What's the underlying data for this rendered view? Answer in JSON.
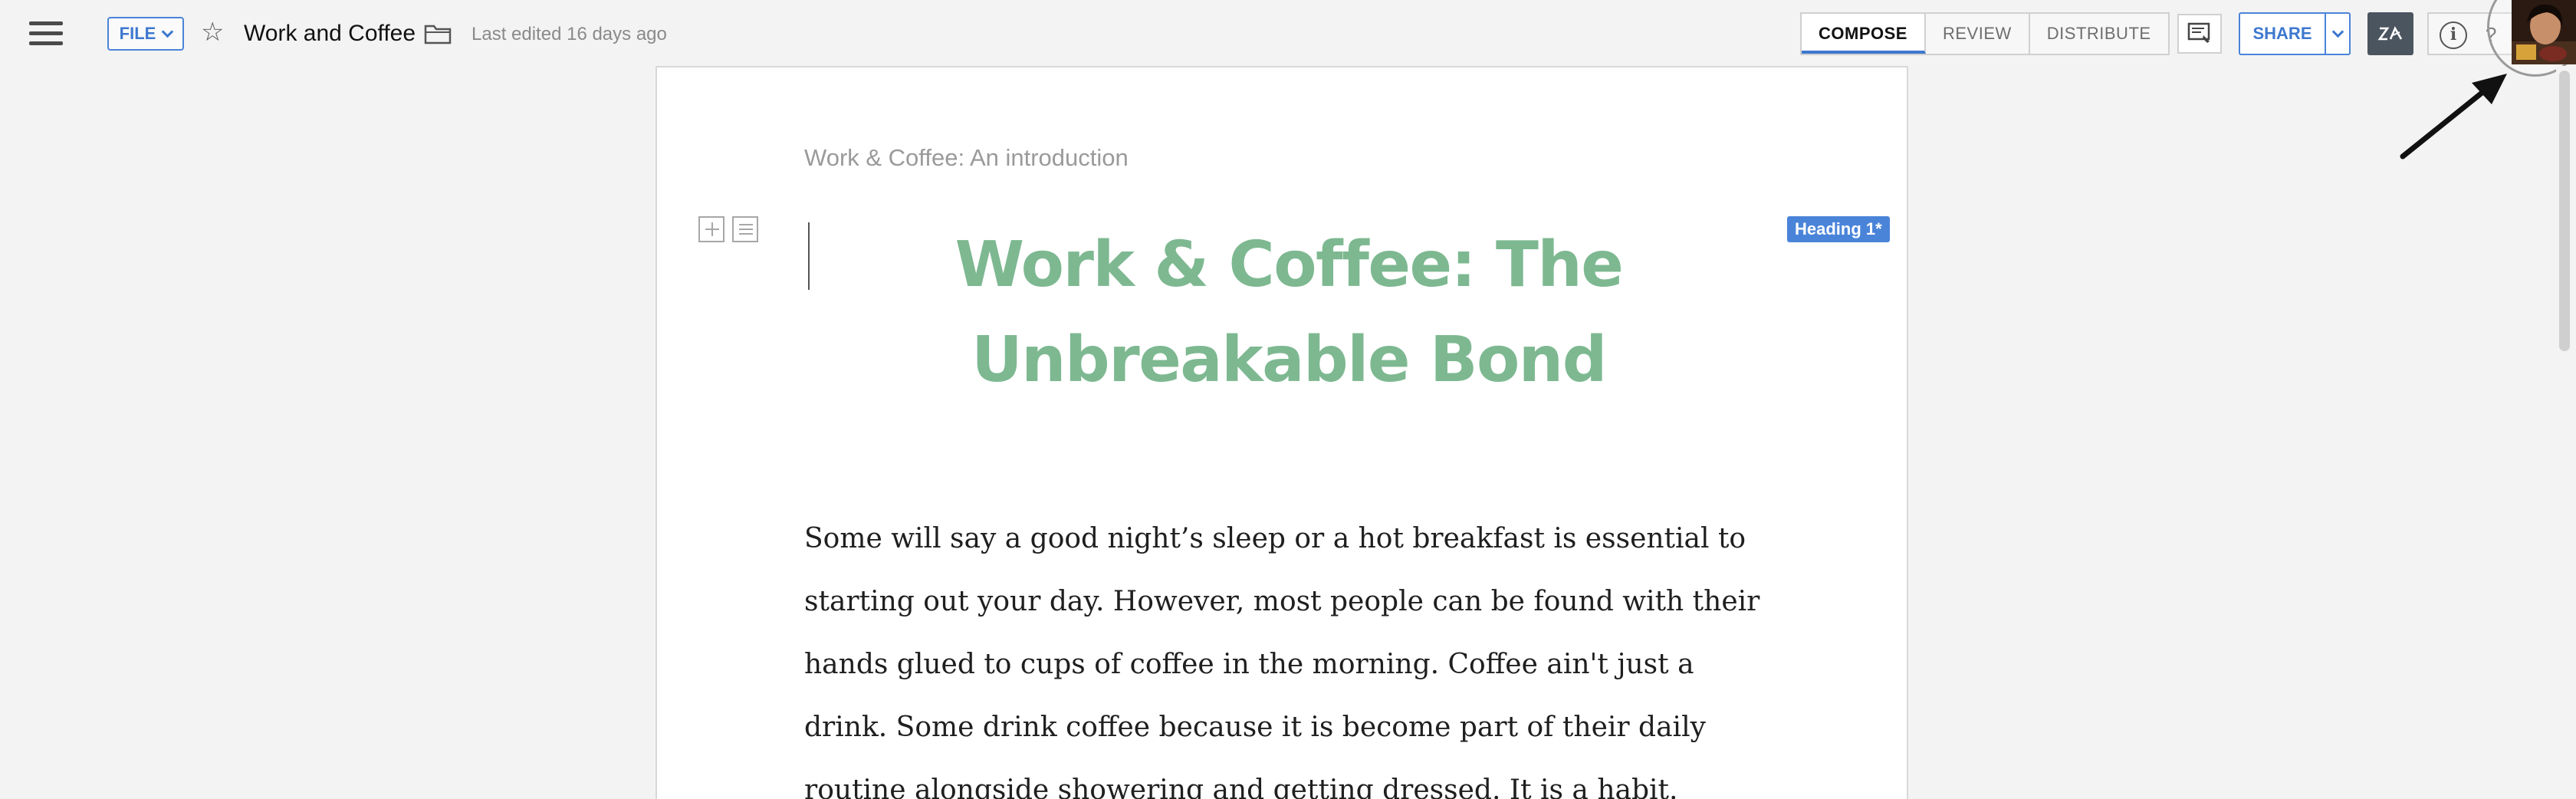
{
  "header": {
    "file_label": "FILE",
    "doc_title": "Work and Coffee",
    "last_edited": "Last edited 16 days ago",
    "modes": [
      "COMPOSE",
      "REVIEW",
      "DISTRIBUTE"
    ],
    "active_mode": "COMPOSE",
    "share_label": "SHARE",
    "zia_label": "Zia",
    "info_label": "i",
    "help_label": "?"
  },
  "document": {
    "subtitle": "Work & Coffee: An introduction",
    "style_badge": "Heading 1*",
    "heading": "Work & Coffee: The Unbreakable Bond",
    "paragraph": "Some will say a good night’s sleep or a hot breakfast is essential to starting out your day. However, most people can be found with their hands glued to cups of coffee in the morning. Coffee ain't just a drink. Some drink coffee because it is become part of their daily routine alongside showering and getting dressed. It is a habit."
  },
  "colors": {
    "accent": "#4a84d9",
    "heading": "#7db891",
    "zia_bg": "#4a5560"
  },
  "icons": [
    "hamburger-menu-icon",
    "chevron-down-icon",
    "star-icon",
    "folder-icon",
    "notes-icon",
    "zia-icon",
    "info-icon",
    "help-icon",
    "add-block-icon",
    "paragraph-icon"
  ]
}
